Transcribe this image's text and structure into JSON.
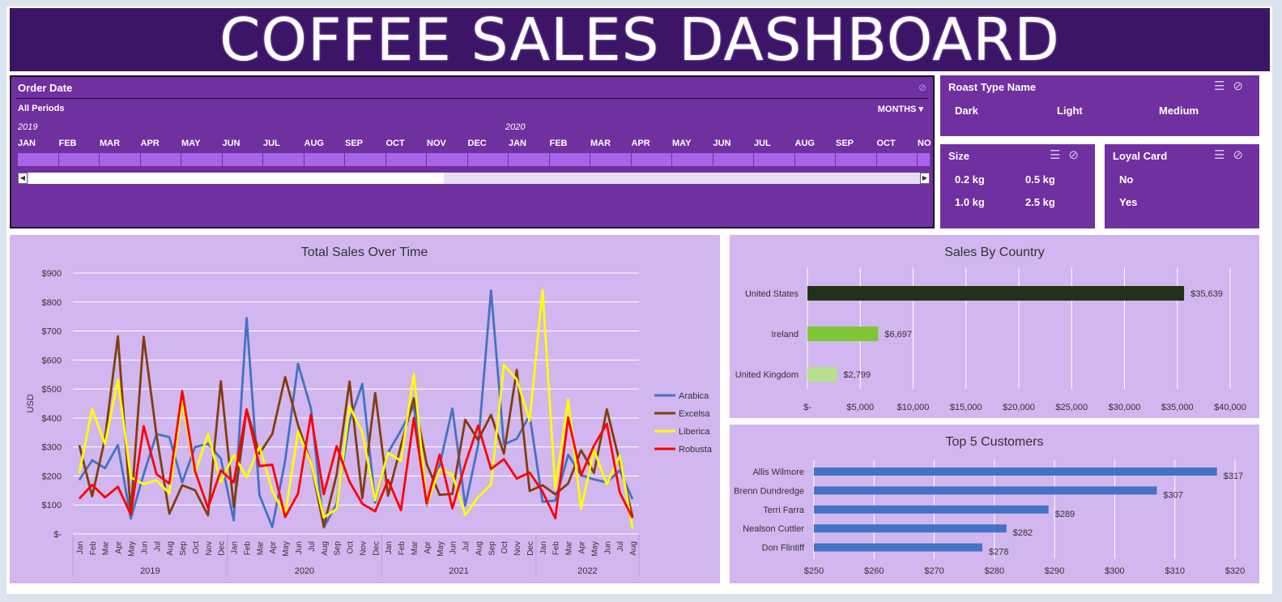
{
  "dashboard": {
    "title": "COFFEE SALES DASHBOARD"
  },
  "timeline": {
    "header": "Order Date",
    "period_label": "All Periods",
    "granularity": "MONTHS",
    "years": [
      "2019",
      "2020"
    ],
    "months": [
      "JAN",
      "FEB",
      "MAR",
      "APR",
      "MAY",
      "JUN",
      "JUL",
      "AUG",
      "SEP",
      "OCT",
      "NOV",
      "DEC",
      "JAN",
      "FEB",
      "MAR",
      "APR",
      "MAY",
      "JUN",
      "JUL",
      "AUG",
      "SEP",
      "OCT",
      "NO"
    ]
  },
  "roast_slicer": {
    "header": "Roast Type Name",
    "items": [
      "Dark",
      "Light",
      "Medium"
    ]
  },
  "size_slicer": {
    "header": "Size",
    "items": [
      "0.2 kg",
      "0.5 kg",
      "1.0 kg",
      "2.5 kg"
    ]
  },
  "loyal_slicer": {
    "header": "Loyal Card",
    "items": [
      "No",
      "Yes"
    ]
  },
  "colors": {
    "title_bg": "#3d1566",
    "panel": "#7030a0",
    "card": "#d1b6ef",
    "arabica": "#4472c4",
    "excelsa": "#843c0c",
    "liberica": "#ffff00",
    "robusta": "#ff0000",
    "us_bar": "#233118",
    "ireland_bar": "#7ec636",
    "uk_bar": "#b8e08c",
    "customer_bar": "#4472c4"
  },
  "chart_data": [
    {
      "type": "line",
      "title": "Total Sales Over Time",
      "ylabel": "USD",
      "ylim": [
        0,
        900
      ],
      "y_ticks": [
        "$-",
        "$100",
        "$200",
        "$300",
        "$400",
        "$500",
        "$600",
        "$700",
        "$800",
        "$900"
      ],
      "x": [
        "Jan",
        "Feb",
        "Mar",
        "Apr",
        "May",
        "Jun",
        "Jul",
        "Aug",
        "Sep",
        "Oct",
        "Nov",
        "Dec",
        "Jan",
        "Feb",
        "Mar",
        "Apr",
        "May",
        "Jun",
        "Jul",
        "Aug",
        "Sep",
        "Oct",
        "Nov",
        "Dec",
        "Jan",
        "Feb",
        "Mar",
        "Apr",
        "May",
        "Jun",
        "Jul",
        "Aug",
        "Sep",
        "Oct",
        "Nov",
        "Dec",
        "Jan",
        "Feb",
        "Mar",
        "Apr",
        "May",
        "Jun",
        "Jul",
        "Aug"
      ],
      "x_groups": [
        {
          "label": "2019",
          "count": 12
        },
        {
          "label": "2020",
          "count": 12
        },
        {
          "label": "2021",
          "count": 12
        },
        {
          "label": "2022",
          "count": 8
        }
      ],
      "legend": "right",
      "series": [
        {
          "name": "Arabica",
          "values": [
            186,
            254,
            227,
            307,
            53,
            206,
            345,
            334,
            178,
            300,
            311,
            260,
            47,
            745,
            134,
            24,
            253,
            587,
            434,
            22,
            104,
            389,
            517,
            108,
            281,
            357,
            443,
            99,
            236,
            433,
            98,
            306,
            840,
            309,
            328,
            410,
            111,
            115,
            273,
            203,
            188,
            178,
            219,
            120
          ]
        },
        {
          "name": "Excelsa",
          "values": [
            306,
            130,
            330,
            682,
            75,
            680,
            340,
            70,
            168,
            151,
            64,
            527,
            93,
            429,
            277,
            345,
            541,
            376,
            245,
            26,
            205,
            526,
            123,
            486,
            132,
            305,
            468,
            241,
            135,
            138,
            394,
            324,
            411,
            277,
            566,
            148,
            168,
            137,
            174,
            289,
            211,
            430,
            248,
            58
          ]
        },
        {
          "name": "Liberica",
          "values": [
            210,
            431,
            310,
            532,
            195,
            172,
            185,
            140,
            459,
            210,
            345,
            179,
            272,
            196,
            302,
            148,
            64,
            353,
            245,
            57,
            86,
            441,
            350,
            116,
            280,
            252,
            552,
            102,
            223,
            205,
            65,
            127,
            171,
            583,
            533,
            390,
            842,
            155,
            464,
            86,
            290,
            171,
            270,
            18
          ]
        },
        {
          "name": "Robusta",
          "values": [
            122,
            169,
            126,
            163,
            67,
            372,
            206,
            174,
            493,
            216,
            90,
            219,
            178,
            430,
            234,
            239,
            58,
            139,
            412,
            137,
            303,
            180,
            104,
            78,
            186,
            82,
            400,
            105,
            274,
            88,
            241,
            374,
            224,
            258,
            191,
            212,
            146,
            54,
            401,
            202,
            304,
            380,
            143,
            55
          ]
        }
      ]
    },
    {
      "type": "bar",
      "title": "Sales By Country",
      "categories": [
        "United States",
        "Ireland",
        "United Kingdom"
      ],
      "values": [
        35639,
        6697,
        2799
      ],
      "data_labels": [
        "$35,639",
        "$6,697",
        "$2,799"
      ],
      "xlim": [
        0,
        40000
      ],
      "x_ticks": [
        "$-",
        "$5,000",
        "$10,000",
        "$15,000",
        "$20,000",
        "$25,000",
        "$30,000",
        "$35,000",
        "$40,000"
      ]
    },
    {
      "type": "bar",
      "title": "Top 5 Customers",
      "categories": [
        "Allis Wilmore",
        "Brenn Dundredge",
        "Terri Farra",
        "Nealson Cuttler",
        "Don Flintiff"
      ],
      "values": [
        317,
        307,
        289,
        282,
        278
      ],
      "data_labels": [
        "$317",
        "$307",
        "$289",
        "$282",
        "$278"
      ],
      "xlim": [
        250,
        320
      ],
      "x_ticks": [
        "$250",
        "$260",
        "$270",
        "$280",
        "$290",
        "$300",
        "$310",
        "$320"
      ]
    }
  ]
}
